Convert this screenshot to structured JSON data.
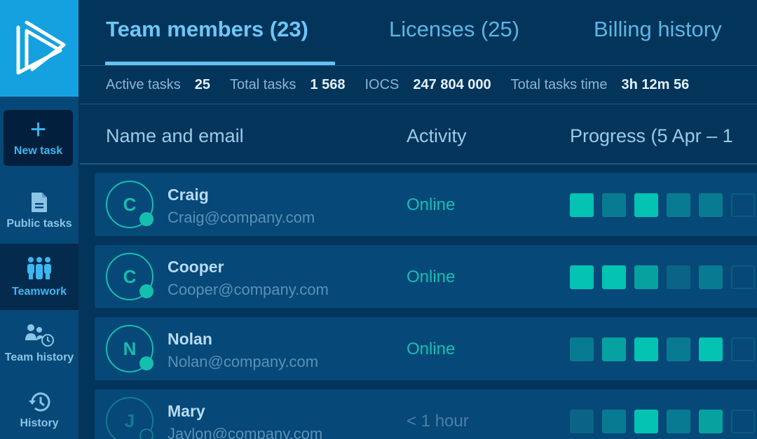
{
  "sidebar": {
    "logo_icon": "play-triangles-logo",
    "new_task": {
      "icon": "plus-icon",
      "label": "New task"
    },
    "items": [
      {
        "label": "Public tasks",
        "icon": "document-icon",
        "active": false
      },
      {
        "label": "Teamwork",
        "icon": "team-icon",
        "active": true
      },
      {
        "label": "Team history",
        "icon": "team-history-icon",
        "active": false
      },
      {
        "label": "History",
        "icon": "history-icon",
        "active": false
      }
    ]
  },
  "tabs": [
    {
      "label": "Team members (23)",
      "active": true
    },
    {
      "label": "Licenses (25)",
      "active": false
    },
    {
      "label": "Billing history",
      "active": false
    }
  ],
  "stats": [
    {
      "label": "Active tasks",
      "value": "25"
    },
    {
      "label": "Total tasks",
      "value": "1 568"
    },
    {
      "label": "IOCS",
      "value": "247 804 000"
    },
    {
      "label": "Total tasks time",
      "value": "3h 12m 56"
    }
  ],
  "columns": {
    "name": "Name and email",
    "activity": "Activity",
    "progress": "Progress (5 Apr – 1"
  },
  "colors": {
    "accent": "#14bfb0",
    "brand": "#15a1e0",
    "background": "#03345a",
    "row": "#064877"
  },
  "members": [
    {
      "initial": "C",
      "name": "Craig",
      "email": "Craig@company.com",
      "activity": "Online",
      "online": true,
      "progress_levels": [
        4,
        2,
        4,
        2,
        2,
        0
      ]
    },
    {
      "initial": "C",
      "name": "Cooper",
      "email": "Cooper@company.com",
      "activity": "Online",
      "online": true,
      "progress_levels": [
        4,
        4,
        3,
        1,
        2,
        0
      ]
    },
    {
      "initial": "N",
      "name": "Nolan",
      "email": "Nolan@company.com",
      "activity": "Online",
      "online": true,
      "progress_levels": [
        2,
        3,
        4,
        2,
        4,
        0
      ]
    },
    {
      "initial": "J",
      "name": "Mary",
      "email": "Jaylon@company.com",
      "activity": "< 1 hour",
      "online": false,
      "progress_levels": [
        1,
        2,
        4,
        2,
        3,
        0
      ]
    }
  ]
}
